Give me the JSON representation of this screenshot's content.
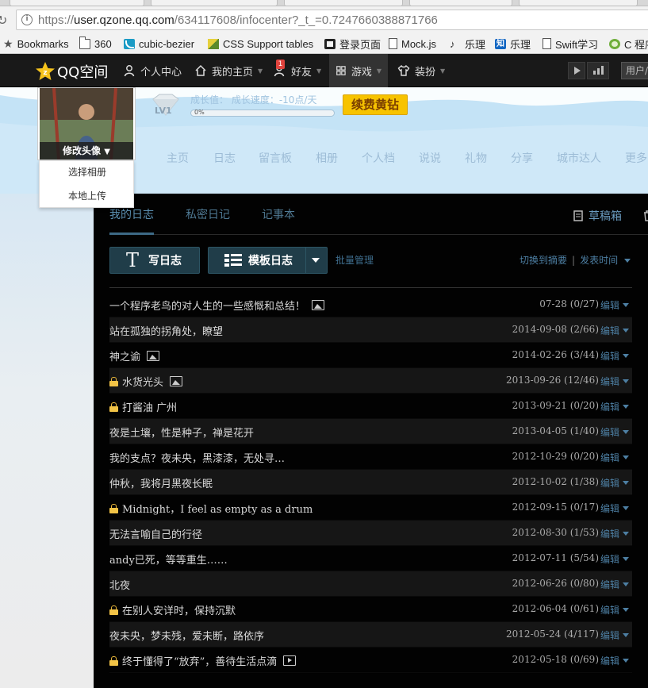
{
  "browser": {
    "url_prefix": "https://",
    "url_host": "user.qzone.qq.com",
    "url_path": "/634117608/infocenter?_t_=0.7247660388871766",
    "bookmarks": [
      "Bookmarks",
      "360",
      "cubic-bezier",
      "CSS Support tables",
      "登录页面",
      "Mock.js",
      "乐理",
      "乐理",
      "Swift学习",
      "C 程序"
    ]
  },
  "qzone": {
    "title": "QQ空间",
    "nav": [
      "个人中心",
      "我的主页",
      "好友",
      "游戏",
      "装扮"
    ],
    "friends_badge": "1",
    "user_button": "用户/"
  },
  "banner": {
    "avatar_caption": "修改头像",
    "avatar_menu": [
      "选择相册",
      "本地上传"
    ],
    "level": "LV1",
    "growth_text": "成长值：  成长速度：-10点/天",
    "growth_percent_label": "0%",
    "growth_progress": 0,
    "renew_button": "续费黄钻",
    "subnav": [
      "主页",
      "日志",
      "留言板",
      "相册",
      "个人档",
      "说说",
      "礼物",
      "分享",
      "城市达人",
      "更多"
    ]
  },
  "blog": {
    "tabs": [
      "我的日志",
      "私密日记",
      "记事本"
    ],
    "drafts_label": "草稿箱",
    "recycle_label": "回",
    "write_button": "写日志",
    "template_button": "模板日志",
    "batch_label": "批量管理",
    "switch_summary": "切换到摘要",
    "sort_label": "发表时间",
    "edit_label": "编辑",
    "entries": [
      {
        "title": "一个程序老鸟的对人生的一些感慨和总结！",
        "date": "07-28",
        "stats": "(0/27)",
        "locked": false,
        "icon": "image-icon"
      },
      {
        "title": "站在孤独的拐角处，瞭望",
        "date": "2014-09-08",
        "stats": "(2/66)",
        "locked": false,
        "icon": ""
      },
      {
        "title": "神之谕",
        "date": "2014-02-26",
        "stats": "(3/44)",
        "locked": false,
        "icon": "image-icon"
      },
      {
        "title": "水货光头",
        "date": "2013-09-26",
        "stats": "(12/46)",
        "locked": true,
        "icon": "image-icon"
      },
      {
        "title": "打酱油 广州",
        "date": "2013-09-21",
        "stats": "(0/20)",
        "locked": true,
        "icon": ""
      },
      {
        "title": "夜是土壤，性是种子，禅是花开",
        "date": "2013-04-05",
        "stats": "(1/40)",
        "locked": false,
        "icon": ""
      },
      {
        "title": "我的支点？夜未央，黑漆漆，无处寻…",
        "date": "2012-10-29",
        "stats": "(0/20)",
        "locked": false,
        "icon": ""
      },
      {
        "title": "仲秋，我将月黑夜长眠",
        "date": "2012-10-02",
        "stats": "(1/38)",
        "locked": false,
        "icon": ""
      },
      {
        "title": "Midnight，I feel as empty as a drum",
        "date": "2012-09-15",
        "stats": "(0/17)",
        "locked": true,
        "icon": ""
      },
      {
        "title": "无法言喻自己的行径",
        "date": "2012-08-30",
        "stats": "(1/53)",
        "locked": false,
        "icon": ""
      },
      {
        "title": "andy已死，等等重生……",
        "date": "2012-07-11",
        "stats": "(5/54)",
        "locked": false,
        "icon": ""
      },
      {
        "title": "北夜",
        "date": "2012-06-26",
        "stats": "(0/80)",
        "locked": false,
        "icon": ""
      },
      {
        "title": "在别人安详时，保持沉默",
        "date": "2012-06-04",
        "stats": "(0/61)",
        "locked": true,
        "icon": ""
      },
      {
        "title": "夜未央，梦未残，爱未断，路依序",
        "date": "2012-05-24",
        "stats": "(4/117)",
        "locked": false,
        "icon": ""
      },
      {
        "title": "终于懂得了“放弃”，善待生活点滴",
        "date": "2012-05-18",
        "stats": "(0/69)",
        "locked": true,
        "icon": "video-icon"
      }
    ]
  }
}
